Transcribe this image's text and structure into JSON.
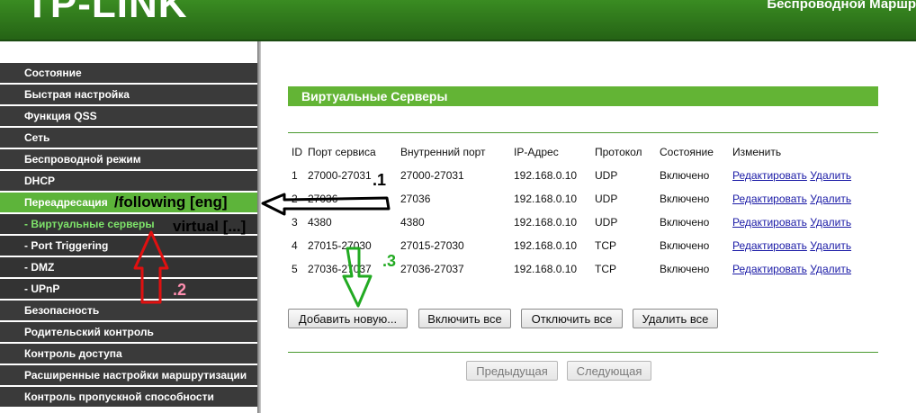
{
  "header": {
    "logo": "TP-LINK",
    "title": "Беспроводной Маршр"
  },
  "sidebar": {
    "items": [
      {
        "label": "Состояние",
        "type": "main"
      },
      {
        "label": "Быстрая настройка",
        "type": "main"
      },
      {
        "label": "Функция QSS",
        "type": "main"
      },
      {
        "label": "Сеть",
        "type": "main"
      },
      {
        "label": "Беспроводной режим",
        "type": "main"
      },
      {
        "label": "DHCP",
        "type": "main"
      },
      {
        "label": "Переадресация",
        "type": "active"
      },
      {
        "label": "- Виртуальные серверы",
        "type": "sub-selected"
      },
      {
        "label": "- Port Triggering",
        "type": "sub"
      },
      {
        "label": "- DMZ",
        "type": "sub"
      },
      {
        "label": "- UPnP",
        "type": "sub"
      },
      {
        "label": "Безопасность",
        "type": "main"
      },
      {
        "label": "Родительский контроль",
        "type": "main"
      },
      {
        "label": "Контроль доступа",
        "type": "main"
      },
      {
        "label": "Расширенные настройки маршрутизации",
        "type": "main"
      },
      {
        "label": "Контроль пропускной способности",
        "type": "main"
      }
    ]
  },
  "main": {
    "section_title": "Виртуальные Серверы",
    "table": {
      "headers": [
        "ID",
        "Порт сервиса",
        "Внутренний порт",
        "IP-Адрес",
        "Протокол",
        "Состояние",
        "Изменить"
      ],
      "rows": [
        {
          "id": "1",
          "service_port": "27000-27031",
          "internal_port": "27000-27031",
          "ip": "192.168.0.10",
          "protocol": "UDP",
          "status": "Включено"
        },
        {
          "id": "2",
          "service_port": "27036",
          "internal_port": "27036",
          "ip": "192.168.0.10",
          "protocol": "UDP",
          "status": "Включено"
        },
        {
          "id": "3",
          "service_port": "4380",
          "internal_port": "4380",
          "ip": "192.168.0.10",
          "protocol": "UDP",
          "status": "Включено"
        },
        {
          "id": "4",
          "service_port": "27015-27030",
          "internal_port": "27015-27030",
          "ip": "192.168.0.10",
          "protocol": "TCP",
          "status": "Включено"
        },
        {
          "id": "5",
          "service_port": "27036-27037",
          "internal_port": "27036-27037",
          "ip": "192.168.0.10",
          "protocol": "TCP",
          "status": "Включено"
        }
      ],
      "edit_label": "Редактировать",
      "delete_label": "Удалить"
    },
    "buttons": {
      "add_new": "Добавить новую...",
      "enable_all": "Включить все",
      "disable_all": "Отключить все",
      "delete_all": "Удалить все",
      "previous": "Предыдущая",
      "next": "Следующая"
    }
  },
  "annotations": {
    "step1_text": "/following [eng]",
    "step1_num": ".1",
    "step2_text": "virtual [...]",
    "step2_num": ".2",
    "step3_num": ".3",
    "colors": {
      "black": "#000000",
      "red": "#e01010",
      "green": "#22aa22",
      "pink": "#ff8fb0"
    }
  }
}
